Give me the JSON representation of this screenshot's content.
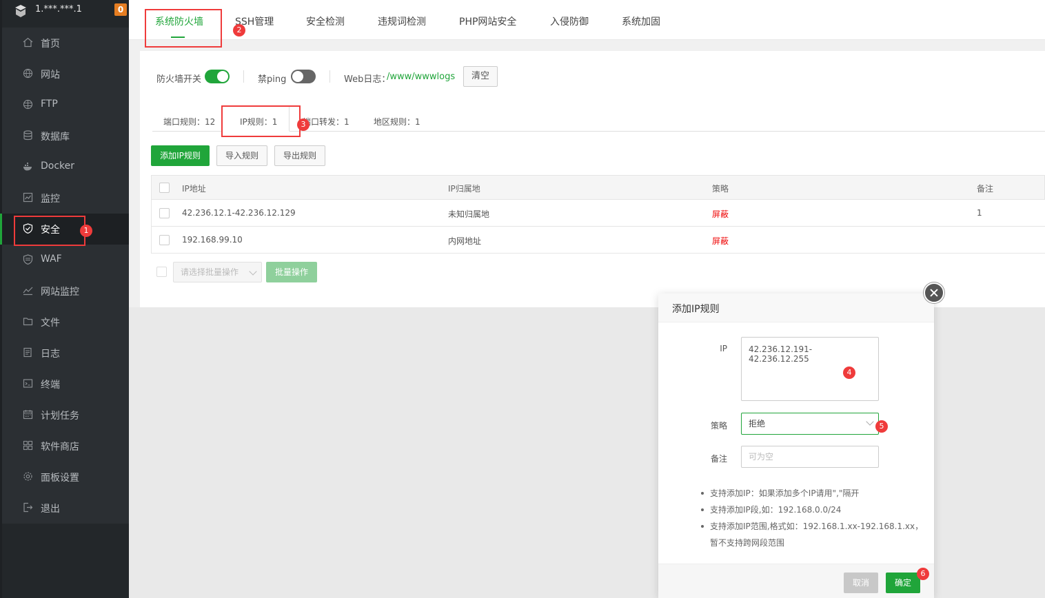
{
  "sidebar": {
    "server": "1.***.***.1",
    "badge": "0",
    "items": [
      {
        "label": "首页",
        "icon": "home-icon"
      },
      {
        "label": "网站",
        "icon": "globe-icon"
      },
      {
        "label": "FTP",
        "icon": "ftp-globe-icon"
      },
      {
        "label": "数据库",
        "icon": "database-icon"
      },
      {
        "label": "Docker",
        "icon": "docker-icon"
      },
      {
        "label": "监控",
        "icon": "monitor-icon"
      },
      {
        "label": "安全",
        "icon": "shield-icon",
        "active": true
      },
      {
        "label": "WAF",
        "icon": "waf-shield-icon"
      },
      {
        "label": "网站监控",
        "icon": "chart-line-icon"
      },
      {
        "label": "文件",
        "icon": "folder-icon"
      },
      {
        "label": "日志",
        "icon": "log-icon"
      },
      {
        "label": "终端",
        "icon": "terminal-icon"
      },
      {
        "label": "计划任务",
        "icon": "calendar-icon"
      },
      {
        "label": "软件商店",
        "icon": "grid-icon"
      },
      {
        "label": "面板设置",
        "icon": "gear-icon"
      },
      {
        "label": "退出",
        "icon": "logout-icon"
      }
    ]
  },
  "toptabs": [
    "系统防火墙",
    "SSH管理",
    "安全检测",
    "违规词检测",
    "PHP网站安全",
    "入侵防御",
    "系统加固"
  ],
  "firewall": {
    "switch_label": "防火墙开关",
    "switch_on": true,
    "ping_label": "禁ping",
    "ping_on": false,
    "weblog_label": "Web日志：",
    "weblog_path": "/www/wwwlogs",
    "clear_label": "清空"
  },
  "subtabs": [
    "端口规则：12",
    "IP规则：1",
    "端口转发：1",
    "地区规则：1"
  ],
  "actions": {
    "add": "添加IP规则",
    "import": "导入规则",
    "export": "导出规则"
  },
  "table": {
    "headers": [
      "IP地址",
      "IP归属地",
      "策略",
      "备注"
    ],
    "rows": [
      [
        "42.236.12.1-42.236.12.129",
        "未知归属地",
        "屏蔽",
        "1"
      ],
      [
        "192.168.99.10",
        "内网地址",
        "屏蔽",
        ""
      ]
    ]
  },
  "batch": {
    "select_placeholder": "请选择批量操作",
    "button": "批量操作"
  },
  "modal": {
    "title": "添加IP规则",
    "ip_label": "IP",
    "ip_value": "42.236.12.191- 42.236.12.255",
    "policy_label": "策略",
    "policy_value": "拒绝",
    "note_label": "备注",
    "note_placeholder": "可为空",
    "tips": [
      "支持添加IP：如果添加多个IP请用\",\"隔开",
      "支持添加IP段,如：192.168.0.0/24",
      "支持添加IP范围,格式如：192.168.1.xx-192.168.1.xx，暂不支持跨网段范围"
    ],
    "cancel": "取消",
    "confirm": "确定"
  },
  "markers": [
    "1",
    "2",
    "3",
    "4",
    "5",
    "6"
  ],
  "colors": {
    "accent": "#20a53a",
    "danger": "#ef0808",
    "marker": "#ef3b3b"
  }
}
